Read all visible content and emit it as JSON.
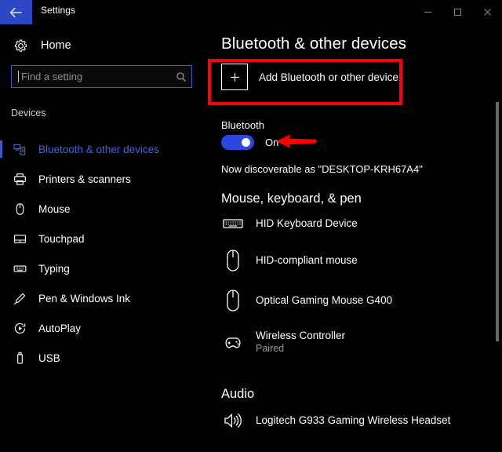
{
  "window": {
    "title": "Settings",
    "back_icon": "back-arrow-icon",
    "minimize_label": "–",
    "maximize_label": "□",
    "close_label": "✕"
  },
  "sidebar": {
    "home": {
      "label": "Home",
      "icon": "gear-icon"
    },
    "search": {
      "value": "",
      "placeholder": "Find a setting",
      "icon": "search-icon"
    },
    "section_label": "Devices",
    "items": [
      {
        "label": "Bluetooth & other devices",
        "icon": "bluetooth-devices-icon",
        "selected": true
      },
      {
        "label": "Printers & scanners",
        "icon": "printer-icon",
        "selected": false
      },
      {
        "label": "Mouse",
        "icon": "mouse-icon",
        "selected": false
      },
      {
        "label": "Touchpad",
        "icon": "touchpad-icon",
        "selected": false
      },
      {
        "label": "Typing",
        "icon": "keyboard-icon",
        "selected": false
      },
      {
        "label": "Pen & Windows Ink",
        "icon": "pen-icon",
        "selected": false
      },
      {
        "label": "AutoPlay",
        "icon": "autoplay-icon",
        "selected": false
      },
      {
        "label": "USB",
        "icon": "usb-icon",
        "selected": false
      }
    ]
  },
  "main": {
    "page_title": "Bluetooth & other devices",
    "add_device": {
      "label": "Add Bluetooth or other device",
      "icon": "plus-icon"
    },
    "bluetooth": {
      "label": "Bluetooth",
      "toggle_state": "On",
      "toggle_on": true,
      "discoverable_text": "Now discoverable as \"DESKTOP-KRH67A4\""
    },
    "groups": [
      {
        "heading": "Mouse, keyboard, & pen",
        "devices": [
          {
            "name": "HID Keyboard Device",
            "status": "",
            "icon": "keyboard-icon"
          },
          {
            "name": "HID-compliant mouse",
            "status": "",
            "icon": "mouse-icon"
          },
          {
            "name": "Optical Gaming Mouse G400",
            "status": "",
            "icon": "mouse-icon"
          },
          {
            "name": "Wireless Controller",
            "status": "Paired",
            "icon": "gamepad-icon"
          }
        ]
      },
      {
        "heading": "Audio",
        "devices": [
          {
            "name": "Logitech G933 Gaming Wireless Headset",
            "status": "",
            "icon": "speaker-icon"
          }
        ]
      }
    ]
  },
  "annotations": {
    "highlight_box": "red-rectangle-highlight",
    "arrow": "red-arrow-pointing-left"
  },
  "colors": {
    "accent_blue": "#2b47c4",
    "selected_text_blue": "#4a63d6",
    "toggle_blue": "#2b47e0",
    "annotation_red": "#ff0000",
    "background": "#000000",
    "muted_text": "#9b9b9b"
  }
}
